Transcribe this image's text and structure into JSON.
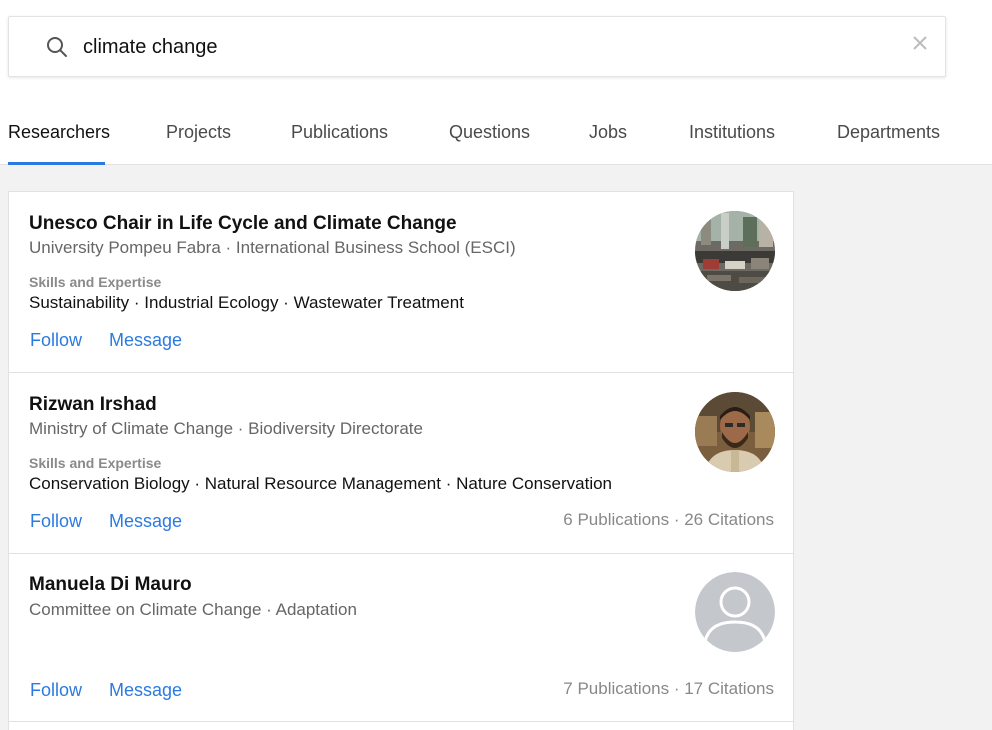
{
  "search": {
    "query": "climate change",
    "search_icon": "search-icon",
    "clear_icon": "close-icon"
  },
  "tabs": [
    {
      "label": "Researchers",
      "active": true
    },
    {
      "label": "Projects"
    },
    {
      "label": "Publications"
    },
    {
      "label": "Questions"
    },
    {
      "label": "Jobs"
    },
    {
      "label": "Institutions"
    },
    {
      "label": "Departments"
    }
  ],
  "results": [
    {
      "name": "Unesco Chair in Life Cycle and Climate Change",
      "affiliation": "University Pompeu Fabra · International Business School (ESCI)",
      "skills_label": "Skills and Expertise",
      "skills": "Sustainability · Industrial Ecology · Wastewater Treatment",
      "follow": "Follow",
      "message": "Message",
      "avatar": "institution-photo"
    },
    {
      "name": "Rizwan Irshad",
      "affiliation": "Ministry of Climate Change · Biodiversity Directorate",
      "skills_label": "Skills and Expertise",
      "skills": "Conservation Biology · Natural Resource Management · Nature Conservation",
      "follow": "Follow",
      "message": "Message",
      "stats": "6 Publications · 26 Citations",
      "avatar": "person-photo"
    },
    {
      "name": "Manuela Di Mauro",
      "affiliation": "Committee on Climate Change · Adaptation",
      "follow": "Follow",
      "message": "Message",
      "stats": "7 Publications · 17 Citations",
      "avatar": "default-avatar-icon"
    }
  ],
  "colors": {
    "accent": "#2a7ae2",
    "muted_text": "#666666",
    "background": "#f2f2f2"
  }
}
